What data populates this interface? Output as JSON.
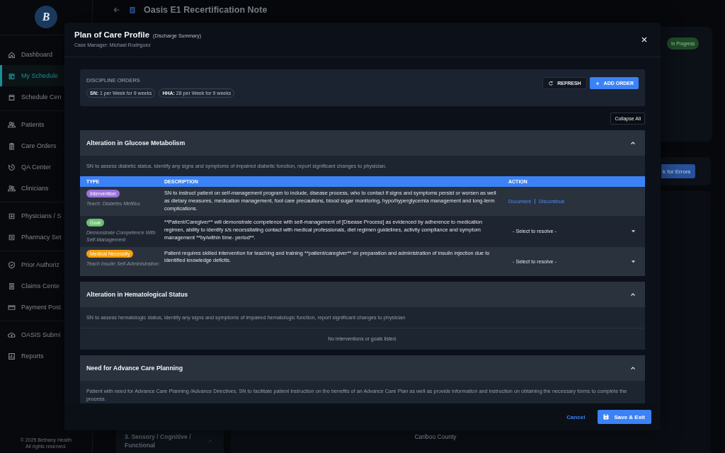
{
  "sidebar": {
    "logo": "B",
    "groups": [
      [
        {
          "label": "Dashboard",
          "selected": false
        },
        {
          "label": "My Schedule",
          "selected": true
        },
        {
          "label": "Schedule Cen",
          "selected": false
        }
      ],
      [
        {
          "label": "Patients",
          "selected": false
        },
        {
          "label": "Care Orders",
          "selected": false
        },
        {
          "label": "QA Center",
          "selected": false
        },
        {
          "label": "Clinicians",
          "selected": false
        }
      ],
      [
        {
          "label": "Physicians / S",
          "selected": false
        },
        {
          "label": "Pharmacy Set",
          "selected": false
        }
      ],
      [
        {
          "label": "Prior Authoriz",
          "selected": false
        },
        {
          "label": "Claims Cente",
          "selected": false
        },
        {
          "label": "Payment Post",
          "selected": false
        }
      ],
      [
        {
          "label": "OASIS Submi",
          "selected": false
        },
        {
          "label": "Reports",
          "selected": false
        }
      ]
    ],
    "footer": [
      "© 2025 Bethany Health",
      "All rights reserved."
    ]
  },
  "page": {
    "title": "Oasis E1 Recertification Note",
    "status": "In Progress",
    "errors_button": "k for Errors",
    "section_item": {
      "label": "3. Sensory / Cognitive / Functional",
      "expanded": true
    },
    "county": "Cariboo County"
  },
  "modal": {
    "title": "Plan of Care Profile",
    "subtitle": "(Discharge Summary)",
    "case_manager": "Case Manager: Michael Rodriguez",
    "discipline_orders": {
      "title": "DISCIPLINE ORDERS",
      "chips": [
        "**SN:** 1 per Week for 9 weeks",
        "**HHA:** 28 per Week for 9 weeks"
      ],
      "refresh": "REFRESH",
      "add": "ADD ORDER"
    },
    "collapse_all": "Collapse All",
    "columns": [
      "TYPE",
      "DESCRIPTION",
      "ACTION"
    ],
    "sections": [
      {
        "title": "Alteration in Glucose Metabolism",
        "expanded": true,
        "description": "SN to assess diabetic status, identify any signs and symptoms of impaired diabetic function, report significant changes to physician.",
        "rows": [
          {
            "tag": "Intervention",
            "color": "#9b72d8",
            "subtitle": "Teach: Diabetes Mellitus",
            "description": "SN to instruct patient on self-management program to include, disease process, who to contact if signs and symptoms persist or worsen as well as dietary measures, medication management, foot care precautions, blood sugar monitoring, hypo/hyperglycemia management and long-term complications.",
            "action": {
              "kind": "links",
              "links": [
                "Document",
                "Discontinue"
              ]
            }
          },
          {
            "tag": "Goal",
            "color": "#6cc070",
            "subtitle": "Demonstrate Competence With Self-Management",
            "description": "**Patient/Caregiver** will demonstrate competence with self-management of [Disease Process] as evidenced by adherence to medication regimen, ability to identify s/s necessitating contact with medical professionals, diet regimen guidelines, activity compliance and symptom management **by/within time- period**.",
            "action": {
              "kind": "select",
              "value": "- Select to resolve -"
            }
          },
          {
            "tag": "Medical Necessity",
            "color": "#f59e0b",
            "subtitle": "Teach Insulin Self-Administration:",
            "description": "Patient requires skilled intervention for teaching and training **patient/caregiver** on preparation and administration of insulin injection due to identified knowledge deficits.",
            "action": {
              "kind": "select",
              "value": "- Select to resolve -"
            }
          }
        ]
      },
      {
        "title": "Alteration in Hematological Status",
        "expanded": true,
        "description": "SN to assess hematologic status, identify any signs and symptoms of impaired hematologic function, report significant changes to physician",
        "empty": "No interventions or goals listed."
      },
      {
        "title": "Need for Advance Care Planning",
        "expanded": true,
        "description": "Patient with need for Advance Care Planning /Advance Directives. SN to facilitate patient instruction on the benefits of an Advance Care Plan as well as provide information and instruction on obtaining the necessary forms to complete the process."
      }
    ],
    "cancel": "Cancel",
    "save": "Save & Exit"
  }
}
